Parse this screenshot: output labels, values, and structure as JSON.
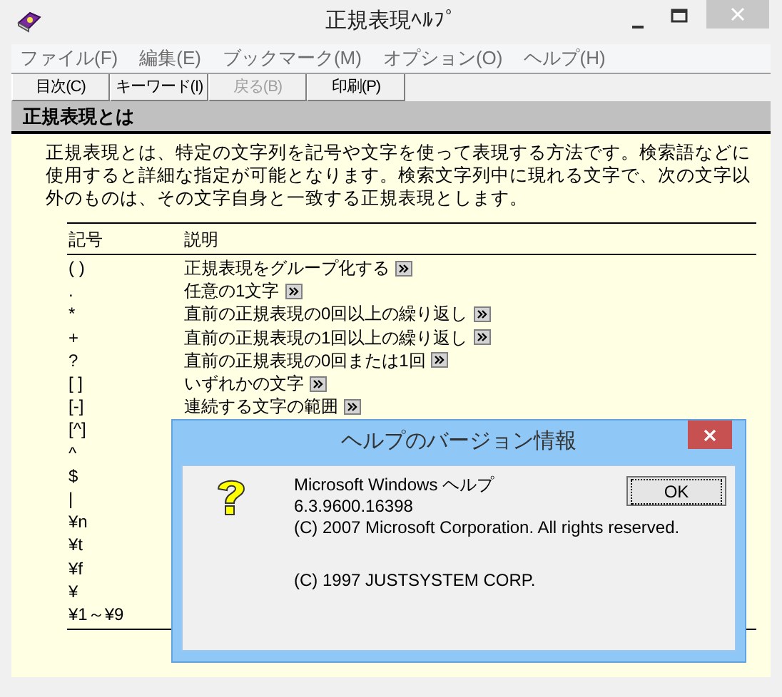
{
  "window": {
    "title": "正規表現ﾍﾙﾌﾟ"
  },
  "menu": [
    "ファイル(F)",
    "編集(E)",
    "ブックマーク(M)",
    "オプション(O)",
    "ヘルプ(H)"
  ],
  "toolbar": [
    {
      "label": "目次(C)",
      "disabled": false
    },
    {
      "label": "キーワード(I)",
      "disabled": false
    },
    {
      "label": "戻る(B)",
      "disabled": true
    },
    {
      "label": "印刷(P)",
      "disabled": false
    }
  ],
  "heading": "正規表現とは",
  "intro": "正規表現とは、特定の文字列を記号や文字を使って表現する方法です。検索語などに使用すると詳細な指定が可能となります。検索文字列中に現れる文字で、次の文字以外のものは、その文字自身と一致する正規表現とします。",
  "table": {
    "columns": [
      "記号",
      "説明"
    ],
    "rows": [
      {
        "symbol": "( )",
        "description": "正規表現をグループ化する"
      },
      {
        "symbol": ".",
        "description": "任意の1文字"
      },
      {
        "symbol": "*",
        "description": "直前の正規表現の0回以上の繰り返し"
      },
      {
        "symbol": "+",
        "description": "直前の正規表現の1回以上の繰り返し"
      },
      {
        "symbol": "?",
        "description": "直前の正規表現の0回または1回"
      },
      {
        "symbol": "[ ]",
        "description": "いずれかの文字"
      },
      {
        "symbol": "[-]",
        "description": "連続する文字の範囲"
      },
      {
        "symbol": "[^]"
      },
      {
        "symbol": "^"
      },
      {
        "symbol": "$"
      },
      {
        "symbol": "|"
      },
      {
        "symbol": "¥n"
      },
      {
        "symbol": "¥t"
      },
      {
        "symbol": "¥f"
      },
      {
        "symbol": "¥"
      },
      {
        "symbol": "¥1～¥9"
      }
    ]
  },
  "dialog": {
    "title": "ヘルプのバージョン情報",
    "lines": [
      "Microsoft Windows ヘルプ",
      "6.3.9600.16398",
      "(C) 2007 Microsoft Corporation. All rights reserved.",
      "(C) 1997 JUSTSYSTEM CORP."
    ],
    "ok": "OK"
  }
}
